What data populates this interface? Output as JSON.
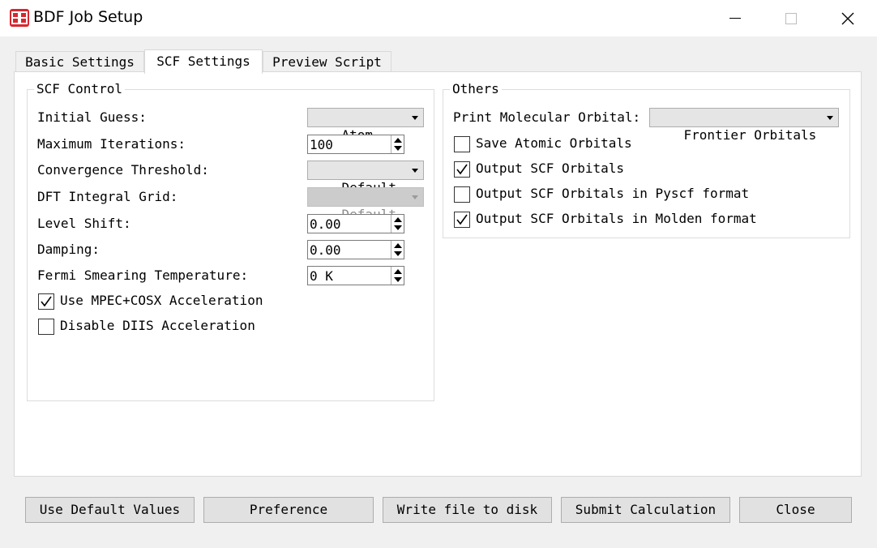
{
  "window": {
    "title": "BDF Job Setup",
    "app_icon": "bdf-logo-icon",
    "controls": [
      "minimize-icon",
      "maximize-icon",
      "close-icon"
    ]
  },
  "tabs": [
    {
      "label": "Basic Settings",
      "active": false
    },
    {
      "label": "SCF Settings",
      "active": true
    },
    {
      "label": "Preview Script",
      "active": false
    }
  ],
  "scf_control": {
    "title": "SCF Control",
    "initial_guess": {
      "label": "Initial Guess:",
      "value": "Atom"
    },
    "max_iterations": {
      "label": "Maximum Iterations:",
      "value": "100"
    },
    "convergence": {
      "label": "Convergence Threshold:",
      "value": "Default"
    },
    "dft_grid": {
      "label": "DFT Integral Grid:",
      "value": "Default",
      "enabled": false
    },
    "level_shift": {
      "label": "Level Shift:",
      "value": "0.00"
    },
    "damping": {
      "label": "Damping:",
      "value": "0.00"
    },
    "fermi": {
      "label": "Fermi Smearing Temperature:",
      "value": "0 K"
    },
    "mpec": {
      "label": "Use MPEC+COSX Acceleration",
      "checked": true
    },
    "diis": {
      "label": "Disable DIIS Acceleration",
      "checked": false
    }
  },
  "others": {
    "title": "Others",
    "print_mo": {
      "label": "Print Molecular Orbital:",
      "value": "Frontier Orbitals"
    },
    "save_atomic": {
      "label": "Save Atomic Orbitals",
      "checked": false
    },
    "output_scf": {
      "label": "Output SCF Orbitals",
      "checked": true
    },
    "output_pyscf": {
      "label": "Output SCF Orbitals in Pyscf format",
      "checked": false
    },
    "output_molden": {
      "label": "Output SCF Orbitals in Molden format",
      "checked": true
    }
  },
  "buttons": {
    "defaults": "Use Default Values",
    "preference": "Preference",
    "write": "Write file to disk",
    "submit": "Submit Calculation",
    "close": "Close"
  }
}
